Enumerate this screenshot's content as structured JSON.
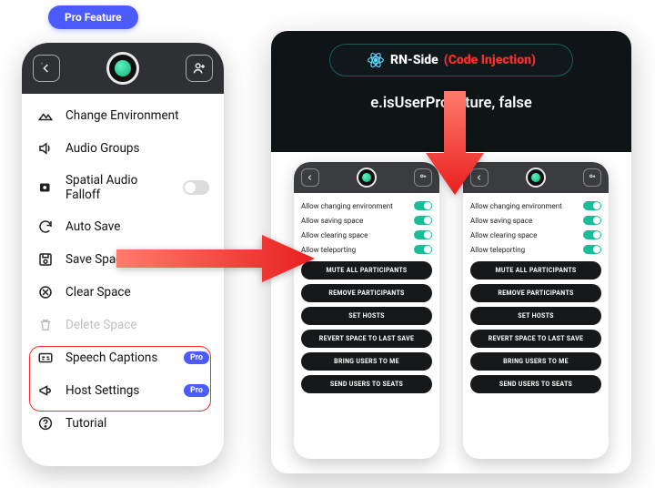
{
  "pro_badge": "Pro Feature",
  "left_menu": {
    "change_env": "Change Environment",
    "audio_groups": "Audio Groups",
    "spatial_falloff": "Spatial Audio Falloff",
    "auto_save": "Auto Save",
    "save_space": "Save Space",
    "clear_space": "Clear Space",
    "delete_space": "Delete Space",
    "speech_captions": "Speech Captions",
    "host_settings": "Host Settings",
    "tutorial": "Tutorial",
    "pro_pill": "Pro"
  },
  "panel": {
    "rn_side": "RN-Side",
    "code_injection": "(Code Injection)",
    "code_line": "e.isUserPro = ture, false"
  },
  "mini": {
    "allow_env": "Allow changing environment",
    "allow_saving": "Allow saving space",
    "allow_clearing": "Allow clearing space",
    "allow_teleport": "Allow teleporting",
    "mute_all": "MUTE ALL PARTICIPANTS",
    "remove_parts": "REMOVE PARTICIPANTS",
    "set_hosts": "SET HOSTS",
    "revert": "REVERT SPACE TO LAST SAVE",
    "bring": "BRING USERS TO ME",
    "send": "SEND USERS TO SEATS"
  }
}
